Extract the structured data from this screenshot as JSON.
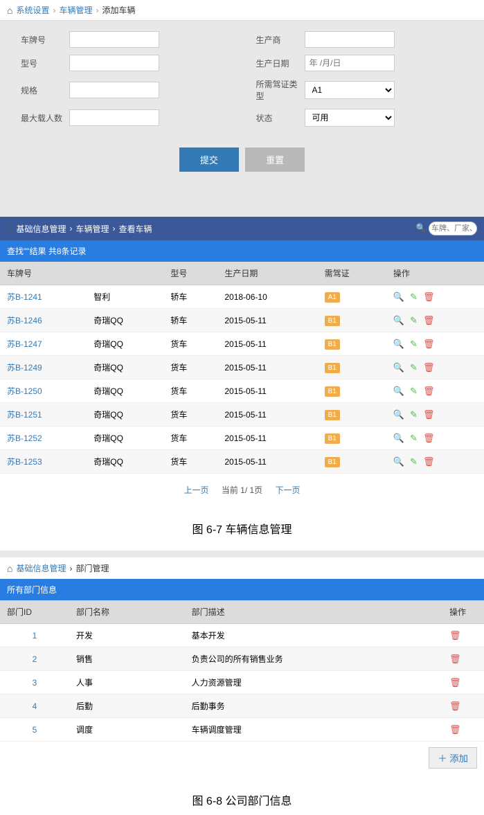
{
  "section1": {
    "breadcrumb": {
      "home": "系统设置",
      "mid": "车辆管理",
      "last": "添加车辆"
    },
    "form": {
      "plate_label": "车牌号",
      "maker_label": "生产商",
      "model_label": "型号",
      "date_label": "生产日期",
      "date_placeholder": "年 /月/日",
      "spec_label": "规格",
      "license_label": "所需驾证类型",
      "license_value": "A1",
      "capacity_label": "最大载人数",
      "status_label": "状态",
      "status_value": "可用",
      "submit": "提交",
      "reset": "重置"
    }
  },
  "section2": {
    "breadcrumb": {
      "home": "基础信息管理",
      "mid": "车辆管理",
      "last": "查看车辆"
    },
    "search_placeholder": "车牌、厂家、型号",
    "result_bar": "查找\"\"结果  共8条记录",
    "headers": {
      "plate": "车牌号",
      "model": "型号",
      "date": "生产日期",
      "license": "需驾证",
      "ops": "操作"
    },
    "rows": [
      {
        "plate": "苏B-1241",
        "maker": "智利",
        "model": "轿车",
        "date": "2018-06-10",
        "license": "A1"
      },
      {
        "plate": "苏B-1246",
        "maker": "奇瑞QQ",
        "model": "轿车",
        "date": "2015-05-11",
        "license": "B1"
      },
      {
        "plate": "苏B-1247",
        "maker": "奇瑞QQ",
        "model": "货车",
        "date": "2015-05-11",
        "license": "B1"
      },
      {
        "plate": "苏B-1249",
        "maker": "奇瑞QQ",
        "model": "货车",
        "date": "2015-05-11",
        "license": "B1"
      },
      {
        "plate": "苏B-1250",
        "maker": "奇瑞QQ",
        "model": "货车",
        "date": "2015-05-11",
        "license": "B1"
      },
      {
        "plate": "苏B-1251",
        "maker": "奇瑞QQ",
        "model": "货车",
        "date": "2015-05-11",
        "license": "B1"
      },
      {
        "plate": "苏B-1252",
        "maker": "奇瑞QQ",
        "model": "货车",
        "date": "2015-05-11",
        "license": "B1"
      },
      {
        "plate": "苏B-1253",
        "maker": "奇瑞QQ",
        "model": "货车",
        "date": "2015-05-11",
        "license": "B1"
      }
    ],
    "pager": {
      "prev": "上一页",
      "info": "当前 1/ 1页",
      "next": "下一页"
    },
    "caption": "图 6-7 车辆信息管理"
  },
  "section3": {
    "breadcrumb": {
      "home": "基础信息管理",
      "last": "部门管理"
    },
    "bar": "所有部门信息",
    "headers": {
      "id": "部门ID",
      "name": "部门名称",
      "desc": "部门描述",
      "ops": "操作"
    },
    "rows": [
      {
        "id": "1",
        "name": "开发",
        "desc": "基本开发"
      },
      {
        "id": "2",
        "name": "销售",
        "desc": "负责公司的所有销售业务"
      },
      {
        "id": "3",
        "name": "人事",
        "desc": "人力资源管理"
      },
      {
        "id": "4",
        "name": "后勤",
        "desc": "后勤事务"
      },
      {
        "id": "5",
        "name": "调度",
        "desc": "车辆调度管理"
      }
    ],
    "add_label": "添加",
    "caption": "图 6-8  公司部门信息"
  }
}
